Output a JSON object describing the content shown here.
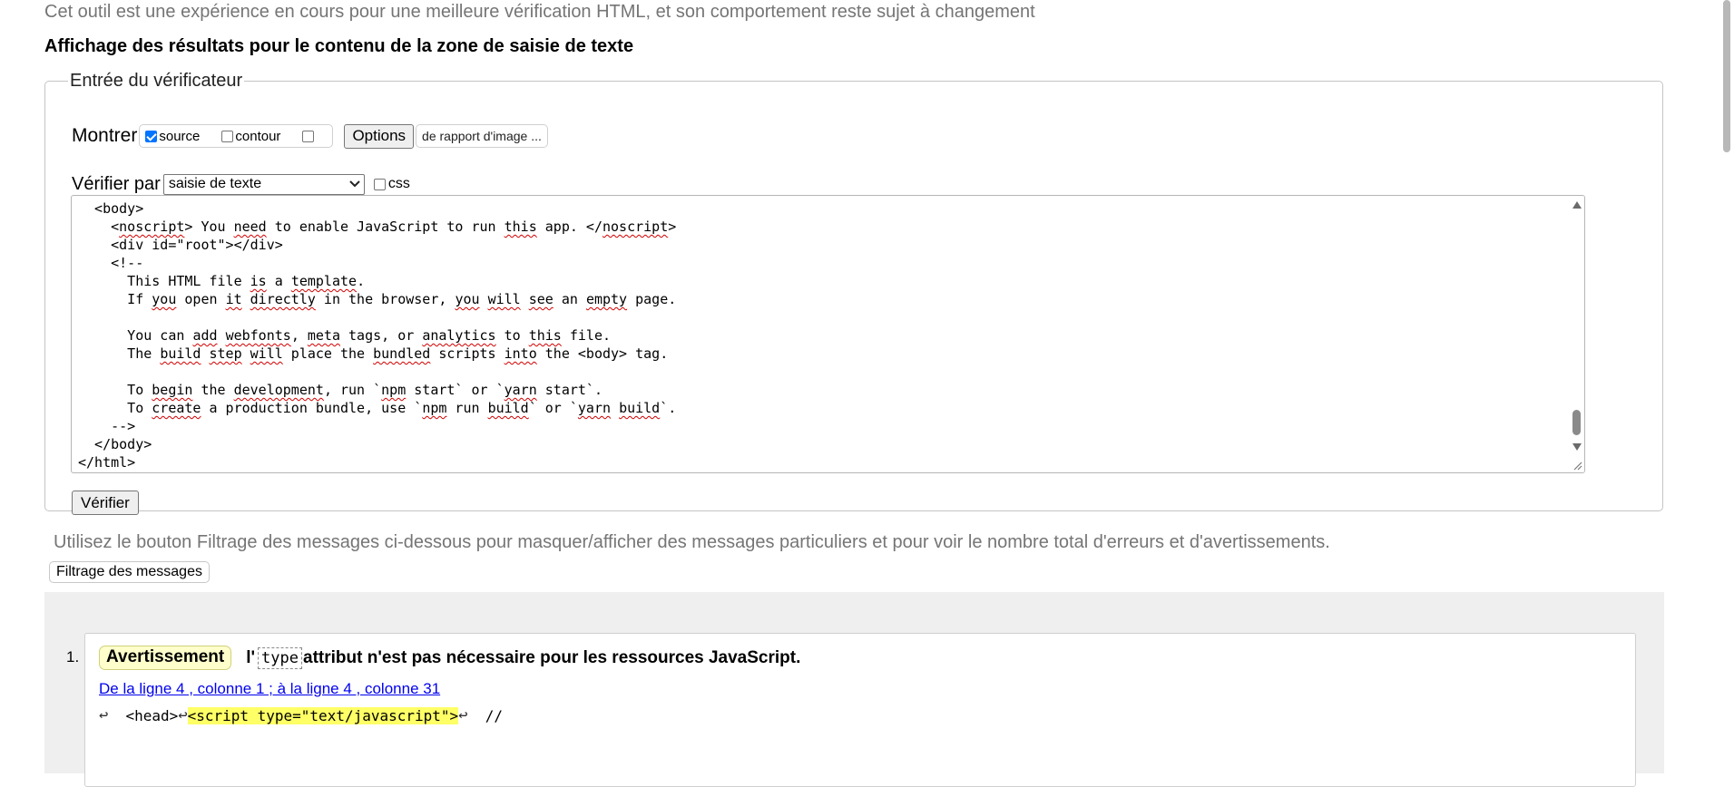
{
  "notice": "Cet outil est une expérience en cours pour une meilleure vérification HTML, et son comportement reste sujet à changement",
  "results_title": "Affichage des résultats pour le contenu de la zone de saisie de texte",
  "input_box": {
    "legend": "Entrée du vérificateur",
    "show_label": "Montrer",
    "options": {
      "source": {
        "label": "source",
        "checked": true
      },
      "outline": {
        "label": "contour",
        "checked": false
      },
      "image_report": {
        "checked": false
      }
    },
    "options_button": "Options",
    "image_report_label": "de rapport d'image ...",
    "check_by_label": "Vérifier par",
    "check_by_value": "saisie de texte",
    "css_label": "css",
    "css_checked": false,
    "verify_button": "Vérifier"
  },
  "editor": {
    "lines": [
      "  <body>",
      "    <noscript> You need to enable JavaScript to run this app. </noscript>",
      "    <div id=\"root\"></div>",
      "    <!--",
      "      This HTML file is a template.",
      "      If you open it directly in the browser, you will see an empty page.",
      "",
      "      You can add webfonts, meta tags, or analytics to this file.",
      "      The build step will place the bundled scripts into the <body> tag.",
      "",
      "      To begin the development, run `npm start` or `yarn start`.",
      "      To create a production bundle, use `npm run build` or `yarn build`.",
      "    -->",
      "  </body>",
      "</html>"
    ]
  },
  "filter_hint": "Utilisez le bouton Filtrage des messages ci-dessous pour masquer/afficher des messages particuliers et pour voir le nombre total d'erreurs et d'avertissements.",
  "filter_button": "Filtrage des messages",
  "messages": [
    {
      "number": "1.",
      "badge": "Avertissement",
      "text_before": "l'",
      "code": "type",
      "text_after": "attribut n'est pas nécessaire pour les ressources JavaScript.",
      "location": "De la ligne 4 , colonne 1 ; à la ligne 4 , colonne 31",
      "extract_before": "  <head>",
      "extract_highlight": "<script type=\"text/javascript\">",
      "extract_after": "  //",
      "return_glyph": "↩"
    }
  ],
  "colors": {
    "badge_bg": "#ffffcc",
    "highlight": "#ffff66",
    "link": "#0000ee",
    "message_area_bg": "#efefef",
    "checkbox_checked": "#0075ff"
  }
}
